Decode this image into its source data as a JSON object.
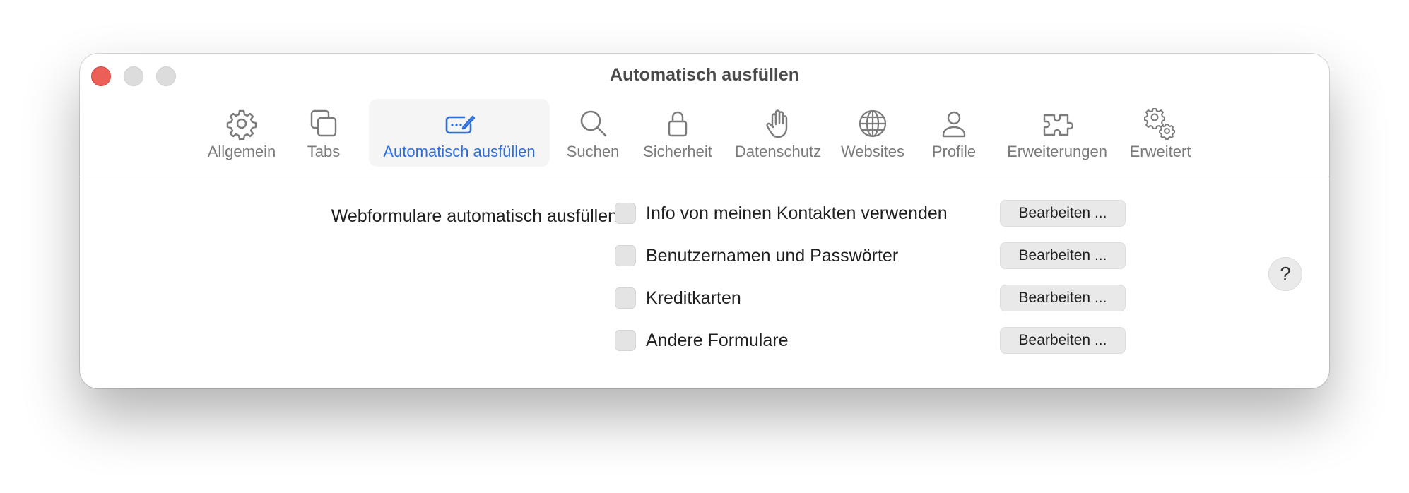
{
  "window": {
    "title": "Automatisch ausfüllen"
  },
  "toolbar": {
    "tabs": [
      {
        "label": "Allgemein",
        "icon": "gear-icon",
        "active": false
      },
      {
        "label": "Tabs",
        "icon": "tabs-icon",
        "active": false
      },
      {
        "label": "Automatisch ausfüllen",
        "icon": "autofill-icon",
        "active": true
      },
      {
        "label": "Suchen",
        "icon": "search-icon",
        "active": false
      },
      {
        "label": "Sicherheit",
        "icon": "lock-icon",
        "active": false
      },
      {
        "label": "Datenschutz",
        "icon": "hand-icon",
        "active": false
      },
      {
        "label": "Websites",
        "icon": "globe-icon",
        "active": false
      },
      {
        "label": "Profile",
        "icon": "person-icon",
        "active": false
      },
      {
        "label": "Erweiterungen",
        "icon": "puzzle-icon",
        "active": false
      },
      {
        "label": "Erweitert",
        "icon": "gears-icon",
        "active": false
      }
    ]
  },
  "autofill": {
    "section_label": "Webformulare automatisch ausfüllen:",
    "options": [
      {
        "label": "Info von meinen Kontakten verwenden",
        "checked": false,
        "button": "Bearbeiten ..."
      },
      {
        "label": "Benutzernamen und Passwörter",
        "checked": false,
        "button": "Bearbeiten ..."
      },
      {
        "label": "Kreditkarten",
        "checked": false,
        "button": "Bearbeiten ..."
      },
      {
        "label": "Andere Formulare",
        "checked": false,
        "button": "Bearbeiten ..."
      }
    ],
    "help": "?"
  },
  "colors": {
    "accent": "#2f6fdd",
    "close": "#ec5f57",
    "inactive_button": "#dcdcdc"
  }
}
